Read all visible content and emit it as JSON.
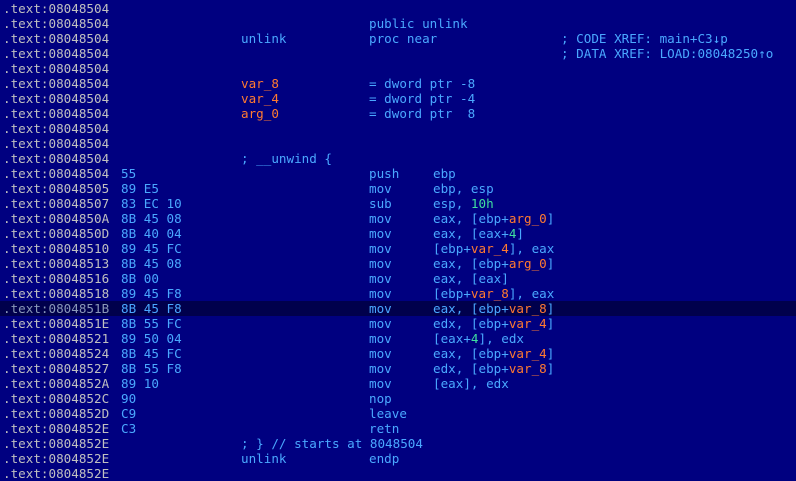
{
  "disassembly": {
    "lines": [
      {
        "addr": ".text:08048504",
        "bytes": "",
        "label": "",
        "mnem": "",
        "ops": "",
        "xref": ""
      },
      {
        "addr": ".text:08048504",
        "bytes": "",
        "label": "",
        "mnem": "public unlink",
        "ops": "",
        "xref": ""
      },
      {
        "addr": ".text:08048504",
        "bytes": "",
        "label": "unlink",
        "mnem": "proc near",
        "ops": "",
        "xref": "; CODE XREF: main+C3↓p"
      },
      {
        "addr": ".text:08048504",
        "bytes": "",
        "label": "",
        "mnem": "",
        "ops": "",
        "xref": "; DATA XREF: LOAD:08048250↑o"
      },
      {
        "addr": ".text:08048504",
        "bytes": "",
        "label": "",
        "mnem": "",
        "ops": "",
        "xref": ""
      },
      {
        "addr": ".text:08048504",
        "bytes": "",
        "label": "var_8",
        "label_kind": "var",
        "mnem": "= dword ptr -8",
        "ops": "",
        "xref": ""
      },
      {
        "addr": ".text:08048504",
        "bytes": "",
        "label": "var_4",
        "label_kind": "var",
        "mnem": "= dword ptr -4",
        "ops": "",
        "xref": ""
      },
      {
        "addr": ".text:08048504",
        "bytes": "",
        "label": "arg_0",
        "label_kind": "var",
        "mnem": "= dword ptr  8",
        "ops": "",
        "xref": ""
      },
      {
        "addr": ".text:08048504",
        "bytes": "",
        "label": "",
        "mnem": "",
        "ops": "",
        "xref": ""
      },
      {
        "addr": ".text:08048504",
        "bytes": "",
        "label": "",
        "mnem": "",
        "ops": "",
        "xref": ""
      },
      {
        "addr": ".text:08048504",
        "bytes": "",
        "label": "; __unwind {",
        "label_kind": "cmt",
        "mnem": "",
        "ops": "",
        "xref": ""
      },
      {
        "addr": ".text:08048504",
        "bytes": "55",
        "label": "",
        "mnem": "push",
        "ops": [
          [
            "ebp",
            "plain"
          ]
        ],
        "xref": ""
      },
      {
        "addr": ".text:08048505",
        "bytes": "89 E5",
        "label": "",
        "mnem": "mov",
        "ops": [
          [
            "ebp, esp",
            "plain"
          ]
        ],
        "xref": ""
      },
      {
        "addr": ".text:08048507",
        "bytes": "83 EC 10",
        "label": "",
        "mnem": "sub",
        "ops": [
          [
            "esp, ",
            "plain"
          ],
          [
            "10h",
            "num"
          ]
        ],
        "xref": ""
      },
      {
        "addr": ".text:0804850A",
        "bytes": "8B 45 08",
        "label": "",
        "mnem": "mov",
        "ops": [
          [
            "eax, [ebp+",
            "plain"
          ],
          [
            "arg_0",
            "var"
          ],
          [
            "]",
            "plain"
          ]
        ],
        "xref": ""
      },
      {
        "addr": ".text:0804850D",
        "bytes": "8B 40 04",
        "label": "",
        "mnem": "mov",
        "ops": [
          [
            "eax, [eax+",
            "plain"
          ],
          [
            "4",
            "num"
          ],
          [
            "]",
            "plain"
          ]
        ],
        "xref": ""
      },
      {
        "addr": ".text:08048510",
        "bytes": "89 45 FC",
        "label": "",
        "mnem": "mov",
        "ops": [
          [
            "[ebp+",
            "plain"
          ],
          [
            "var_4",
            "var"
          ],
          [
            "], eax",
            "plain"
          ]
        ],
        "xref": ""
      },
      {
        "addr": ".text:08048513",
        "bytes": "8B 45 08",
        "label": "",
        "mnem": "mov",
        "ops": [
          [
            "eax, [ebp+",
            "plain"
          ],
          [
            "arg_0",
            "var"
          ],
          [
            "]",
            "plain"
          ]
        ],
        "xref": ""
      },
      {
        "addr": ".text:08048516",
        "bytes": "8B 00",
        "label": "",
        "mnem": "mov",
        "ops": [
          [
            "eax, [eax]",
            "plain"
          ]
        ],
        "xref": ""
      },
      {
        "addr": ".text:08048518",
        "bytes": "89 45 F8",
        "label": "",
        "mnem": "mov",
        "ops": [
          [
            "[ebp+",
            "plain"
          ],
          [
            "var_8",
            "var"
          ],
          [
            "], eax",
            "plain"
          ]
        ],
        "xref": ""
      },
      {
        "addr": ".text:0804851B",
        "bytes": "8B 45 F8",
        "label": "",
        "mnem": "mov",
        "ops": [
          [
            "eax, [ebp+",
            "plain"
          ],
          [
            "var_8",
            "var"
          ],
          [
            "]",
            "plain"
          ]
        ],
        "xref": "",
        "selected": true
      },
      {
        "addr": ".text:0804851E",
        "bytes": "8B 55 FC",
        "label": "",
        "mnem": "mov",
        "ops": [
          [
            "edx, [ebp+",
            "plain"
          ],
          [
            "var_4",
            "var"
          ],
          [
            "]",
            "plain"
          ]
        ],
        "xref": ""
      },
      {
        "addr": ".text:08048521",
        "bytes": "89 50 04",
        "label": "",
        "mnem": "mov",
        "ops": [
          [
            "[eax+",
            "plain"
          ],
          [
            "4",
            "num"
          ],
          [
            "], edx",
            "plain"
          ]
        ],
        "xref": ""
      },
      {
        "addr": ".text:08048524",
        "bytes": "8B 45 FC",
        "label": "",
        "mnem": "mov",
        "ops": [
          [
            "eax, [ebp+",
            "plain"
          ],
          [
            "var_4",
            "var"
          ],
          [
            "]",
            "plain"
          ]
        ],
        "xref": ""
      },
      {
        "addr": ".text:08048527",
        "bytes": "8B 55 F8",
        "label": "",
        "mnem": "mov",
        "ops": [
          [
            "edx, [ebp+",
            "plain"
          ],
          [
            "var_8",
            "var"
          ],
          [
            "]",
            "plain"
          ]
        ],
        "xref": ""
      },
      {
        "addr": ".text:0804852A",
        "bytes": "89 10",
        "label": "",
        "mnem": "mov",
        "ops": [
          [
            "[eax], edx",
            "plain"
          ]
        ],
        "xref": ""
      },
      {
        "addr": ".text:0804852C",
        "bytes": "90",
        "label": "",
        "mnem": "nop",
        "ops": "",
        "xref": ""
      },
      {
        "addr": ".text:0804852D",
        "bytes": "C9",
        "label": "",
        "mnem": "leave",
        "ops": "",
        "xref": ""
      },
      {
        "addr": ".text:0804852E",
        "bytes": "C3",
        "label": "",
        "mnem": "retn",
        "ops": "",
        "xref": ""
      },
      {
        "addr": ".text:0804852E",
        "bytes": "",
        "label": "; } // starts at 8048504",
        "label_kind": "cmt",
        "mnem": "",
        "ops": "",
        "xref": ""
      },
      {
        "addr": ".text:0804852E",
        "bytes": "",
        "label": "unlink",
        "mnem": "endp",
        "ops": "",
        "xref": ""
      },
      {
        "addr": ".text:0804852E",
        "bytes": "",
        "label": "",
        "mnem": "",
        "ops": "",
        "xref": ""
      }
    ]
  },
  "colors": {
    "background": "#000080",
    "address": "#c0c0c0",
    "code": "#4aa8ff",
    "variable": "#ff7a30",
    "number": "#3fe0a0"
  }
}
